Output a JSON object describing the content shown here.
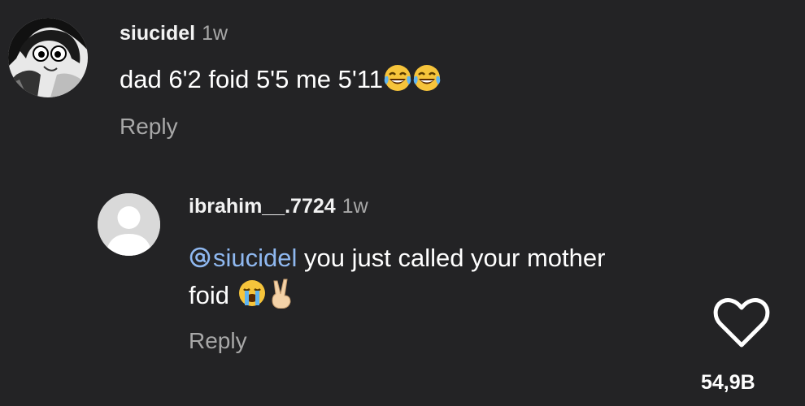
{
  "comments": [
    {
      "username": "siucidel",
      "time": "1w",
      "text": "dad 6'2 foid 5'5 me 5'11",
      "emojis": [
        "face-with-tears-of-joy",
        "face-with-tears-of-joy"
      ],
      "reply_label": "Reply",
      "avatar": "anime-character-avatar"
    },
    {
      "username": "ibrahim__.7724",
      "time": "1w",
      "mention": "siucidel",
      "text_line1": " you just called your mother",
      "text_line2": "foid ",
      "emojis": [
        "loudly-crying-face",
        "victory-hand"
      ],
      "reply_label": "Reply",
      "avatar": "default-user-avatar"
    }
  ],
  "like": {
    "icon": "heart-outline-icon",
    "count": "54,9B"
  },
  "colors": {
    "background": "#232325",
    "text": "#ffffff",
    "muted": "#a8a8a8",
    "mention": "#8fb8f0"
  }
}
